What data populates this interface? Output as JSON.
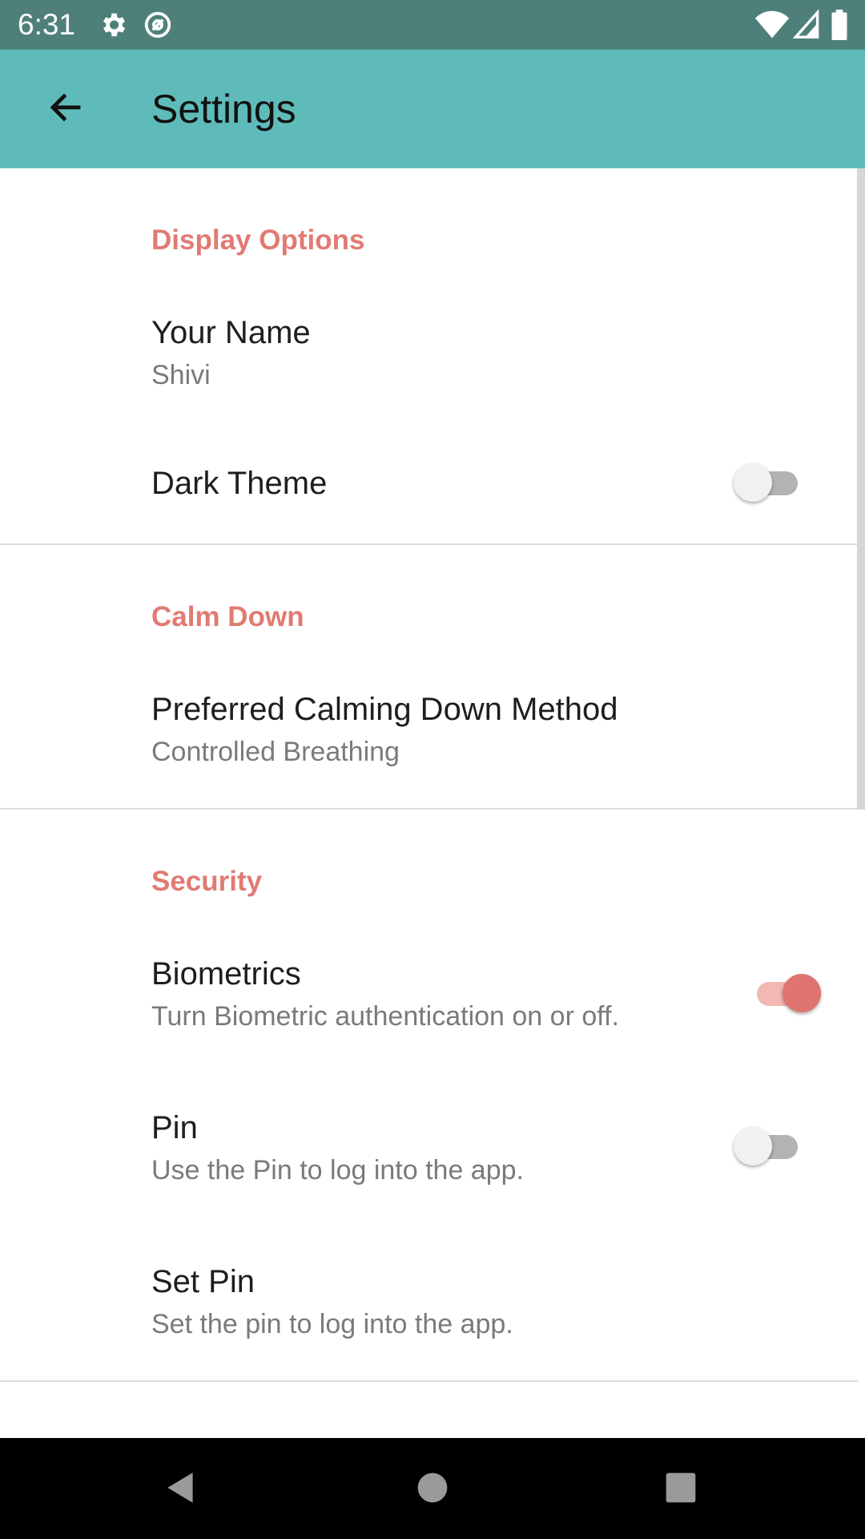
{
  "status_bar": {
    "time": "6:31",
    "icons": [
      "gear-icon",
      "at-icon",
      "wifi-icon",
      "signal-icon",
      "battery-icon"
    ]
  },
  "app_bar": {
    "title": "Settings",
    "back_icon": "arrow-back-icon"
  },
  "sections": {
    "display": {
      "header": "Display Options",
      "your_name": {
        "title": "Your Name",
        "summary": "Shivi"
      },
      "dark_theme": {
        "title": "Dark Theme",
        "enabled": false
      }
    },
    "calm": {
      "header": "Calm Down",
      "method": {
        "title": "Preferred Calming Down Method",
        "summary": "Controlled Breathing"
      }
    },
    "security": {
      "header": "Security",
      "biometrics": {
        "title": "Biometrics",
        "summary": "Turn Biometric authentication on or off.",
        "enabled": true
      },
      "pin": {
        "title": "Pin",
        "summary": "Use the Pin to log into the app.",
        "enabled": false
      },
      "set_pin": {
        "title": "Set Pin",
        "summary": "Set the pin to log into the app."
      }
    }
  },
  "nav_bar": {
    "icons": [
      "nav-back-icon",
      "nav-home-icon",
      "nav-recents-icon"
    ]
  },
  "colors": {
    "status_bar": "#4e8079",
    "app_bar": "#5fbbb9",
    "accent": "#e07b73",
    "switch_on_thumb": "#e07470",
    "switch_on_track": "#f2b8b3",
    "switch_off_track": "#b3b3b3"
  }
}
